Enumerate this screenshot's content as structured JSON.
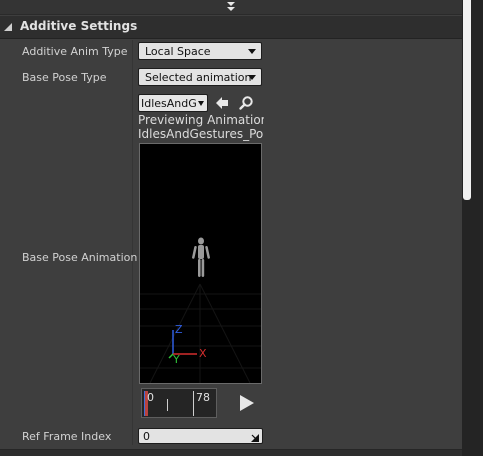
{
  "section": {
    "title": "Additive Settings"
  },
  "rows": {
    "additive_anim_type": {
      "label": "Additive Anim Type",
      "value": "Local Space"
    },
    "base_pose_type": {
      "label": "Base Pose Type",
      "value": "Selected animation"
    },
    "base_pose_animation": {
      "label": "Base Pose Animation",
      "asset_value": "IdlesAndGestures_Pointing",
      "preview_title": "Previewing Animation",
      "preview_asset": "IdlesAndGestures_Pointing"
    },
    "ref_frame_index": {
      "label": "Ref Frame Index",
      "value": "0"
    }
  },
  "timeline": {
    "start_label": "0",
    "end_label": "78"
  },
  "gizmo": {
    "z_label": "Z",
    "x_label": "X",
    "y_label": "Y",
    "z_color": "#2f5de0",
    "x_color": "#d42d2d",
    "y_color": "#2fc23a"
  },
  "icons": {
    "expand": "chevron-down-double-icon",
    "browse_back": "arrow-left-icon",
    "find": "magnifier-icon",
    "play": "play-icon",
    "resize": "resize-corner-icon"
  }
}
